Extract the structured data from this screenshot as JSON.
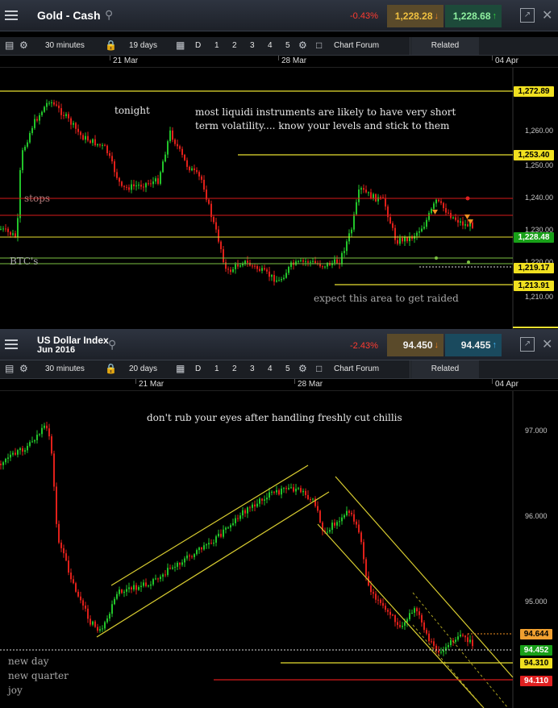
{
  "gold": {
    "title": "Gold - Cash",
    "change": "-0.43%",
    "bid": "1,228.28",
    "ask": "1,228.68",
    "toolbar": {
      "interval": "30 minutes",
      "range": "19 days",
      "d": "D",
      "n1": "1",
      "n2": "2",
      "n3": "3",
      "n4": "4",
      "n5": "5",
      "forum": "Chart Forum",
      "related": "Related"
    },
    "dates": [
      "21 Mar",
      "28 Mar",
      "04 Apr"
    ],
    "axis": [
      "1,260.00",
      "1,250.00",
      "1,240.00",
      "1,230.00",
      "1,220.00",
      "1,210.00"
    ],
    "price_tags": [
      "1,272.89",
      "1,253.40",
      "1,228.48",
      "1,219.17",
      "1,213.91"
    ],
    "notes": {
      "tonight": "tonight",
      "main1": "most liquidi instruments are likely to have very short",
      "main2": "term volatility.... know your levels and stick to them",
      "stops": "stops",
      "btc": "BTC's",
      "raid": "expect this area to get raided"
    }
  },
  "usd": {
    "title1": "US Dollar Index",
    "title2": "Jun 2016",
    "change": "-2.43%",
    "bid": "94.450",
    "ask": "94.455",
    "toolbar": {
      "interval": "30 minutes",
      "range": "20 days",
      "d": "D",
      "n1": "1",
      "n2": "2",
      "n3": "3",
      "n4": "4",
      "n5": "5",
      "forum": "Chart Forum",
      "related": "Related"
    },
    "dates": [
      "21 Mar",
      "28 Mar",
      "04 Apr"
    ],
    "axis": [
      "97.000",
      "96.000",
      "95.000"
    ],
    "price_tags": [
      "94.644",
      "94.452",
      "94.310",
      "94.110"
    ],
    "notes": {
      "chilli": "don't rub your eyes after handling freshly cut chillis",
      "day": "new day",
      "quarter": "new quarter",
      "joy": "joy"
    }
  },
  "colors": {
    "up": "#22c42a",
    "down": "#e0201a",
    "level_yellow": "#e8e030",
    "level_red": "#d81a1a",
    "level_green": "#7cc242"
  }
}
